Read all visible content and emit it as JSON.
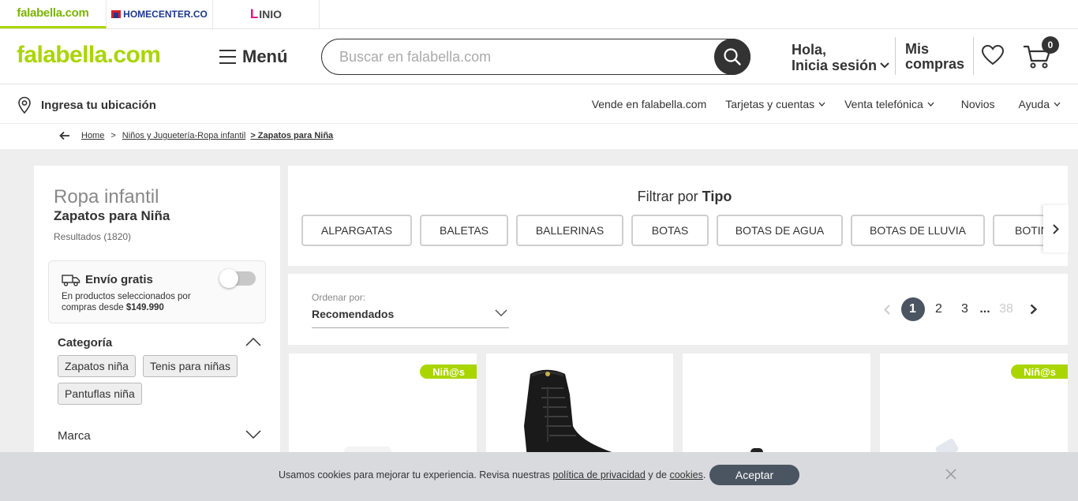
{
  "brands": {
    "falabella": "falabella.com",
    "homecenter": "HOMECENTER.CO",
    "linio": "INIO",
    "linio_initial": "L"
  },
  "header": {
    "logo": "falabella.com",
    "menu_label": "Menú",
    "search_placeholder": "Buscar en falabella.com",
    "greeting": "Hola,",
    "login": "Inicia sesión",
    "mis": "Mis",
    "compras": "compras",
    "cart_count": "0"
  },
  "subheader": {
    "location": "Ingresa tu ubicación",
    "links": {
      "vende": "Vende en falabella.com",
      "tarjetas": "Tarjetas y cuentas",
      "venta": "Venta telefónica",
      "novios": "Novios",
      "ayuda": "Ayuda"
    }
  },
  "breadcrumb": {
    "home": "Home",
    "sep": ">",
    "category": "Niños y Juguetería-Ropa infantil",
    "current": "> Zapatos para Niña"
  },
  "sidebar": {
    "parent_category": "Ropa infantil",
    "title": "Zapatos para Niña",
    "results": "Resultados (1820)",
    "envio": {
      "title": "Envío gratis",
      "desc_1": "En productos seleccionados por",
      "desc_2": "compras desde",
      "amount": "$149.990",
      "enabled": false
    },
    "categoria_label": "Categoría",
    "chips": [
      "Zapatos niña",
      "Tenis para niñas",
      "Pantuflas niña"
    ],
    "marca_label": "Marca"
  },
  "tipo_filter": {
    "prefix": "Filtrar por",
    "name": "Tipo",
    "options": [
      "ALPARGATAS",
      "BALETAS",
      "BALLERINAS",
      "BOTAS",
      "BOTAS DE AGUA",
      "BOTAS DE LLUVIA",
      "BOTINES"
    ]
  },
  "sort": {
    "label": "Ordenar por:",
    "value": "Recomendados"
  },
  "pagination": {
    "pages": [
      "1",
      "2",
      "3"
    ],
    "ellipsis": "...",
    "last": "38",
    "current": "1"
  },
  "products": {
    "badge": "Niñ@s"
  },
  "cookie": {
    "text_1": "Usamos cookies para mejorar tu experiencia. Revisa nuestras",
    "link_1": "política de privacidad",
    "text_2": "y de",
    "link_2": "cookies",
    "text_3": ".",
    "accept": "Aceptar"
  },
  "colors": {
    "brand_green": "#aad500",
    "dark": "#333333",
    "pager_active": "#4a5561"
  }
}
